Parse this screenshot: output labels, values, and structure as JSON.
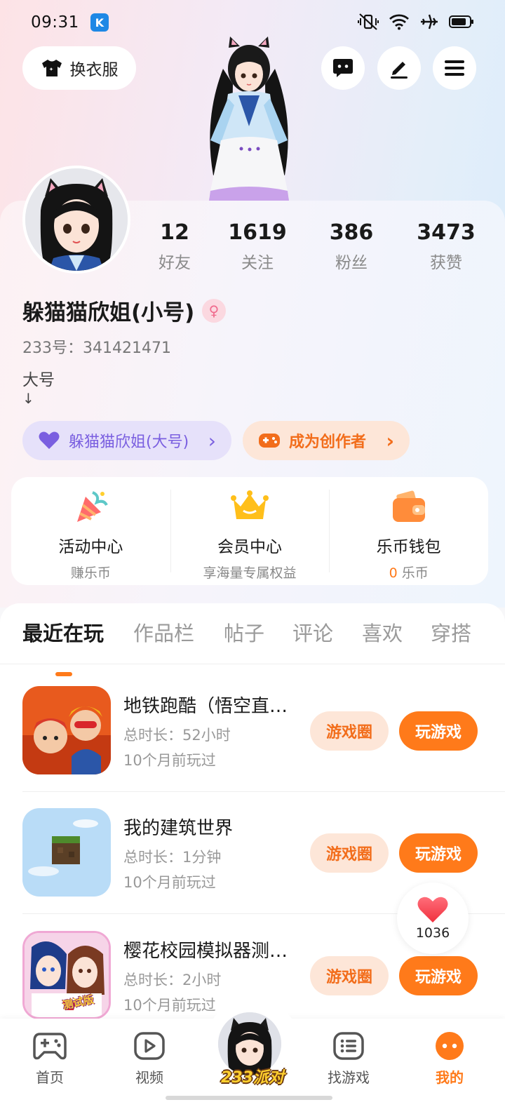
{
  "status_bar": {
    "time": "09:31",
    "app_icon_letter": "K"
  },
  "header": {
    "outfit_label": "换衣服"
  },
  "stats": [
    {
      "value": "12",
      "label": "好友"
    },
    {
      "value": "1619",
      "label": "关注"
    },
    {
      "value": "386",
      "label": "粉丝"
    },
    {
      "value": "3473",
      "label": "获赞"
    }
  ],
  "profile": {
    "nickname": "躲猫猫欣姐(小号)",
    "gender_symbol": "♀",
    "uid": "233号：341421471",
    "bio_line1": "大号",
    "bio_line2": "↓"
  },
  "links": {
    "main_account": "躲猫猫欣姐(大号)",
    "creator": "成为创作者",
    "chevron": "›"
  },
  "quick": [
    {
      "title": "活动中心",
      "sub": "赚乐币"
    },
    {
      "title": "会员中心",
      "sub": "享海量专属权益"
    },
    {
      "title": "乐币钱包",
      "sub_value": "0",
      "sub": " 乐币"
    }
  ],
  "tabs": [
    "最近在玩",
    "作品栏",
    "帖子",
    "评论",
    "喜欢",
    "穿搭"
  ],
  "games": [
    {
      "title": "地铁跑酷（悟空直…",
      "time": "总时长：52小时",
      "last": "10个月前玩过",
      "circle_btn": "游戏圈",
      "play_btn": "玩游戏"
    },
    {
      "title": "我的建筑世界",
      "time": "总时长：1分钟",
      "last": "10个月前玩过",
      "circle_btn": "游戏圈",
      "play_btn": "玩游戏"
    },
    {
      "title": "樱花校园模拟器测…",
      "time": "总时长：2小时",
      "last": "10个月前玩过",
      "circle_btn": "游戏圈",
      "play_btn": "玩游戏",
      "thumb_badge": "测试版"
    }
  ],
  "like_float": {
    "count": "1036"
  },
  "bottom_nav": {
    "home": "首页",
    "video": "视频",
    "center": "233派对",
    "find": "找游戏",
    "me": "我的"
  },
  "colors": {
    "accent": "#ff7a1a",
    "accent_light": "#fde6d8",
    "purple": "#7a5fe0"
  }
}
